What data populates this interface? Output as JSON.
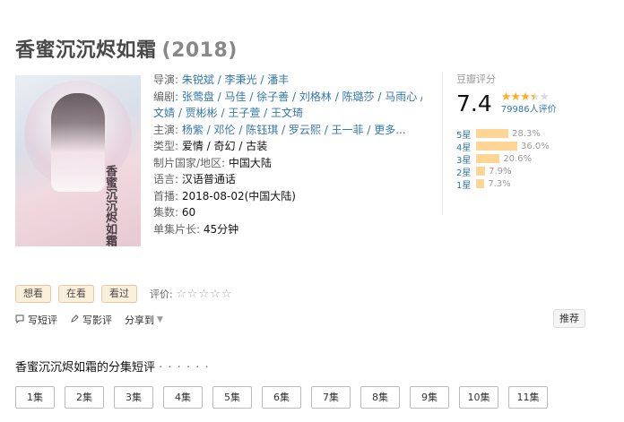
{
  "title": {
    "name": "香蜜沉沉烬如霜",
    "year": "(2018)"
  },
  "poster": {
    "calligraphy": "香蜜沉沉烬如霜"
  },
  "info": {
    "director_label": "导演: ",
    "director": "朱锐斌 / 李秉光 / 潘丰",
    "writer_label": "编剧: ",
    "writer_line1": "张莺盘 / 马佳 / 徐子善 / 刘格林 / 陈璐莎 / 马雨心 / 姜",
    "writer_line2": "文婧 / 贾彬彬 / 王子萱 / 王文琦",
    "cast_label": "主演: ",
    "cast": "杨紫 / 邓伦 / 陈钰琪 / 罗云熙 / 王一菲 / 更多...",
    "genre_label": "类型: ",
    "genre": "爱情 / 奇幻 / 古装",
    "country_label": "制片国家/地区: ",
    "country": "中国大陆",
    "language_label": "语言: ",
    "language": "汉语普通话",
    "premiere_label": "首播: ",
    "premiere": "2018-08-02(中国大陆)",
    "episodes_label": "集数: ",
    "episodes": "60",
    "runtime_label": "单集片长: ",
    "runtime": "45分钟"
  },
  "rating": {
    "title": "豆瓣评分",
    "score": "7.4",
    "stars_full": "★★★",
    "stars_half": "★",
    "stars_empty": "★",
    "votes": "79986人评价",
    "distribution": [
      {
        "label": "5星",
        "pct": "28.3%",
        "value": 28.3
      },
      {
        "label": "4星",
        "pct": "36.0%",
        "value": 36.0
      },
      {
        "label": "3星",
        "pct": "20.6%",
        "value": 20.6
      },
      {
        "label": "2星",
        "pct": "7.9%",
        "value": 7.9
      },
      {
        "label": "1星",
        "pct": "7.3%",
        "value": 7.3
      }
    ]
  },
  "actions": {
    "want": "想看",
    "watching": "在看",
    "watched": "看过",
    "rate_label": "评价:",
    "rate_stars": "☆☆☆☆☆"
  },
  "tools": {
    "short_review": "写短评",
    "review": "写影评",
    "share": "分享到",
    "recommend": "推荐"
  },
  "episode_section": {
    "title": "香蜜沉沉烬如霜的分集短评",
    "dots": "· · · · · ·",
    "episodes": [
      "1集",
      "2集",
      "3集",
      "4集",
      "5集",
      "6集",
      "7集",
      "8集",
      "9集",
      "10集",
      "11集"
    ]
  },
  "colors": {
    "link": "#3377aa",
    "star": "#ffac2d",
    "bar": "#ffd596",
    "button_bg": "#fcf0dc"
  }
}
